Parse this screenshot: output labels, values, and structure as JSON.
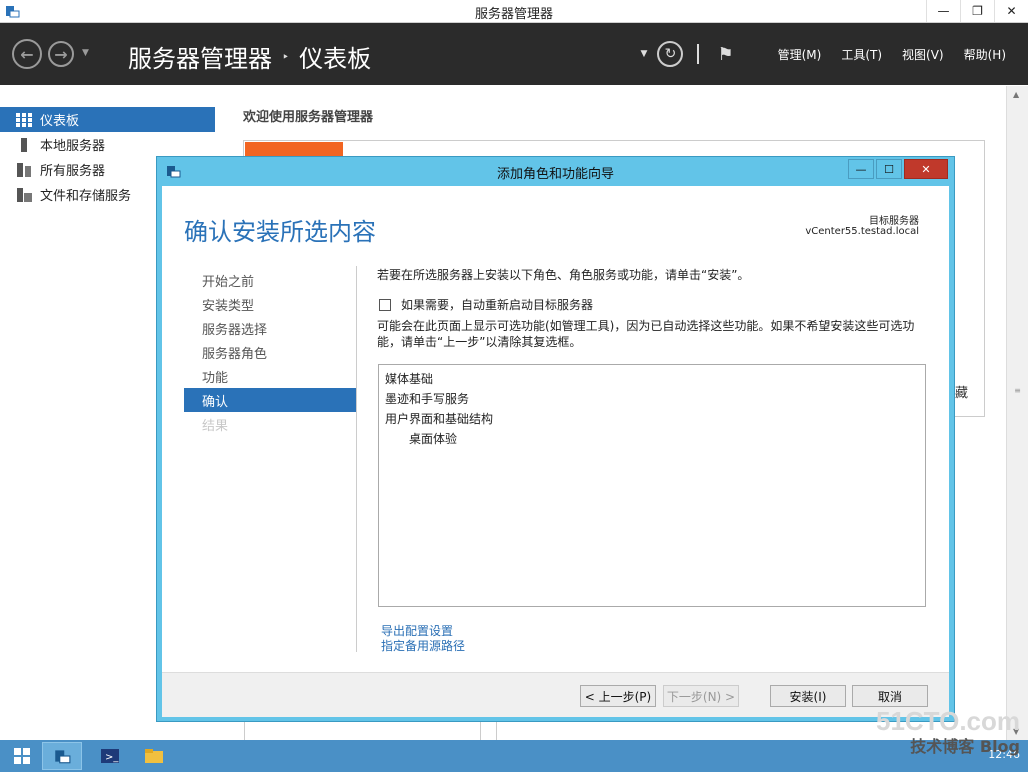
{
  "window": {
    "title": "服务器管理器",
    "minimize": "—",
    "restore": "❐",
    "close": "✕"
  },
  "header": {
    "breadcrumb_root": "服务器管理器",
    "breadcrumb_sep": "‣",
    "breadcrumb_current": "仪表板",
    "menus": [
      "管理(M)",
      "工具(T)",
      "视图(V)",
      "帮助(H)"
    ]
  },
  "sidebar": {
    "items": [
      {
        "label": "仪表板",
        "icon": "dashboard-icon",
        "selected": true
      },
      {
        "label": "本地服务器",
        "icon": "server-icon"
      },
      {
        "label": "所有服务器",
        "icon": "servers-icon"
      },
      {
        "label": "文件和存储服务",
        "icon": "storage-icon"
      }
    ]
  },
  "main": {
    "welcome": "欢迎使用服务器管理器",
    "truncated_text": "藏"
  },
  "dialog": {
    "title": "添加角色和功能向导",
    "heading": "确认安装所选内容",
    "target_label": "目标服务器",
    "target_value": "vCenter55.testad.local",
    "steps": [
      {
        "label": "开始之前",
        "state": "normal"
      },
      {
        "label": "安装类型",
        "state": "normal"
      },
      {
        "label": "服务器选择",
        "state": "normal"
      },
      {
        "label": "服务器角色",
        "state": "normal"
      },
      {
        "label": "功能",
        "state": "normal"
      },
      {
        "label": "确认",
        "state": "selected"
      },
      {
        "label": "结果",
        "state": "disabled"
      }
    ],
    "intro": "若要在所选服务器上安装以下角色、角色服务或功能，请单击“安装”。",
    "restart_checkbox": "如果需要，自动重新启动目标服务器",
    "restart_checked": false,
    "note": "可能会在此页面上显示可选功能(如管理工具)，因为已自动选择这些功能。如果不希望安装这些可选功能，请单击“上一步”以清除其复选框。",
    "features": [
      {
        "label": "媒体基础",
        "level": 0
      },
      {
        "label": "墨迹和手写服务",
        "level": 0
      },
      {
        "label": "用户界面和基础结构",
        "level": 0
      },
      {
        "label": "桌面体验",
        "level": 1
      }
    ],
    "link_export": "导出配置设置",
    "link_source": "指定备用源路径",
    "btn_prev": "< 上一步(P)",
    "btn_next": "下一步(N) >",
    "btn_install": "安装(I)",
    "btn_cancel": "取消"
  },
  "taskbar": {
    "clock": "12:46"
  },
  "watermark": {
    "site": "51CTO.com",
    "sub": "技术博客",
    "blog": "Blog"
  },
  "colors": {
    "accent": "#2a72b8",
    "dialog_frame": "#62c4e8",
    "header_bg": "#2b2b2b",
    "orange": "#f26522",
    "taskbar": "#4a90c6"
  }
}
